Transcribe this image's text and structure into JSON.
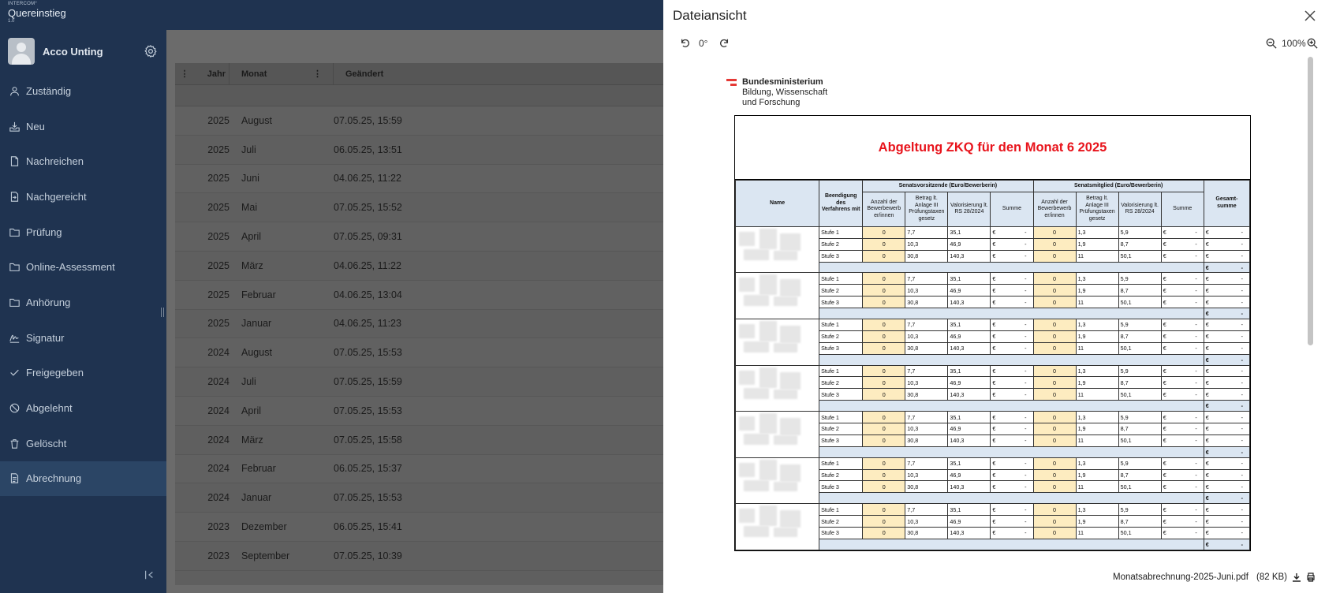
{
  "brand": {
    "small": "INTERCOM°",
    "name": "Quereinstieg",
    "version": "1.0"
  },
  "user": {
    "name": "Acco Unting"
  },
  "nav": [
    {
      "label": "Zuständig",
      "icon": "person-icon"
    },
    {
      "label": "Neu",
      "icon": "inbox-icon"
    },
    {
      "label": "Nachreichen",
      "icon": "document-icon"
    },
    {
      "label": "Nachgereicht",
      "icon": "document-arrow-icon"
    },
    {
      "label": "Prüfung",
      "icon": "folder-icon"
    },
    {
      "label": "Online-Assessment",
      "icon": "folder-icon"
    },
    {
      "label": "Anhörung",
      "icon": "folder-icon"
    },
    {
      "label": "Signatur",
      "icon": "signature-icon"
    },
    {
      "label": "Freigegeben",
      "icon": "check-icon"
    },
    {
      "label": "Abgelehnt",
      "icon": "ban-icon"
    },
    {
      "label": "Gelöscht",
      "icon": "trash-icon"
    },
    {
      "label": "Abrechnung",
      "icon": "receipt-icon",
      "active": true
    }
  ],
  "grid": {
    "headers": {
      "jahr": "Jahr",
      "monat": "Monat",
      "geaendert": "Geändert"
    },
    "rows": [
      {
        "jahr": "2025",
        "monat": "August",
        "geaendert": "07.05.25, 15:59"
      },
      {
        "jahr": "2025",
        "monat": "Juli",
        "geaendert": "06.05.25, 13:51"
      },
      {
        "jahr": "2025",
        "monat": "Juni",
        "geaendert": "04.06.25, 11:22"
      },
      {
        "jahr": "2025",
        "monat": "Mai",
        "geaendert": "07.05.25, 15:52"
      },
      {
        "jahr": "2025",
        "monat": "April",
        "geaendert": "07.05.25, 09:31"
      },
      {
        "jahr": "2025",
        "monat": "März",
        "geaendert": "04.06.25, 11:22"
      },
      {
        "jahr": "2025",
        "monat": "Februar",
        "geaendert": "04.06.25, 13:04"
      },
      {
        "jahr": "2025",
        "monat": "Januar",
        "geaendert": "04.06.25, 11:23"
      },
      {
        "jahr": "2024",
        "monat": "August",
        "geaendert": "07.05.25, 15:53"
      },
      {
        "jahr": "2024",
        "monat": "Juli",
        "geaendert": "07.05.25, 15:59"
      },
      {
        "jahr": "2024",
        "monat": "April",
        "geaendert": "07.05.25, 15:53"
      },
      {
        "jahr": "2024",
        "monat": "März",
        "geaendert": "07.05.25, 15:58"
      },
      {
        "jahr": "2024",
        "monat": "Februar",
        "geaendert": "06.05.25, 15:37"
      },
      {
        "jahr": "2024",
        "monat": "Januar",
        "geaendert": "07.05.25, 15:53"
      },
      {
        "jahr": "2023",
        "monat": "Dezember",
        "geaendert": "06.05.25, 15:41"
      },
      {
        "jahr": "2023",
        "monat": "September",
        "geaendert": "07.05.25, 10:39"
      }
    ]
  },
  "dialog": {
    "title": "Dateiansicht",
    "rotation": "0°",
    "zoom": "100%",
    "file_name": "Monatsabrechnung-2025-Juni.pdf",
    "file_size": "(82 KB)"
  },
  "pdf": {
    "logo_line1": "Bundesministerium",
    "logo_line2": "Bildung, Wissenschaft",
    "logo_line3": "und Forschung",
    "title": "Abgeltung ZKQ für den Monat 6 2025",
    "headers": {
      "name": "Name",
      "beendigung": "Beendigung des Verfahrens mit",
      "senatsvorsitzende": "Senatsvorsitzende (Euro/Bewerberin)",
      "senatsmitglied": "Senatsmitglied (Euro/Bewerberin)",
      "anzahl": "Anzahl der Bewerbewerb er/innen",
      "betrag": "Betrag lt. Anlage III Prüfungstaxen gesetz",
      "valorisierung": "Valorisierung lt. RS 28/2024",
      "summe": "Summe",
      "gesamtsumme": "Gesamt- summe"
    },
    "stufen": [
      {
        "label": "Stufe 1",
        "anzahl_v": "0",
        "betrag_v": "7,7",
        "valor_v": "35,1",
        "anzahl_m": "0",
        "betrag_m": "1,3",
        "valor_m": "5,9"
      },
      {
        "label": "Stufe 2",
        "anzahl_v": "0",
        "betrag_v": "10,3",
        "valor_v": "46,9",
        "anzahl_m": "0",
        "betrag_m": "1,9",
        "valor_m": "8,7"
      },
      {
        "label": "Stufe 3",
        "anzahl_v": "0",
        "betrag_v": "30,8",
        "valor_v": "140,3",
        "anzahl_m": "0",
        "betrag_m": "11",
        "valor_m": "50,1"
      }
    ],
    "currency": "€",
    "dash": "-",
    "group_count": 7
  }
}
